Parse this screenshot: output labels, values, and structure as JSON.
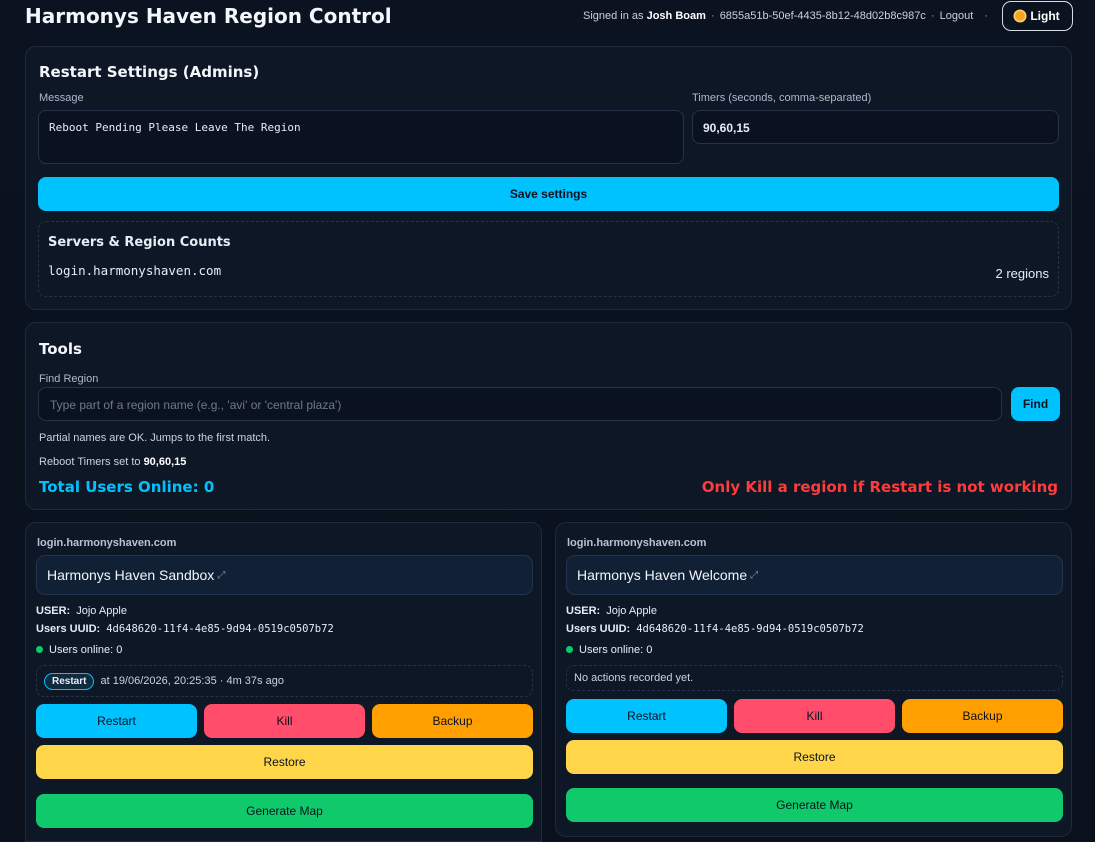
{
  "header": {
    "title": "Harmonys Haven Region Control",
    "signed_in_prefix": "Signed in as",
    "user_name": "Josh Boam",
    "user_uuid": "6855a51b-50ef-4435-8b12-48d02b8c987c",
    "logout_label": "Logout",
    "theme_label": "Light"
  },
  "restart_settings": {
    "title": "Restart Settings (Admins)",
    "message_label": "Message",
    "message_value": "Reboot Pending Please Leave The Region",
    "timers_label": "Timers (seconds, comma-separated)",
    "timers_value": "90,60,15",
    "save_label": "Save settings",
    "servers_title": "Servers & Region Counts",
    "server_host": "login.harmonyshaven.com",
    "server_count": "2 regions"
  },
  "tools": {
    "title": "Tools",
    "find_label": "Find Region",
    "find_placeholder": "Type part of a region name (e.g., 'avi' or 'central plaza')",
    "find_button": "Find",
    "hint": "Partial names are OK. Jumps to the first match.",
    "reboot_prefix": "Reboot Timers set to",
    "reboot_value": "90,60,15",
    "total_users": "Total Users Online: 0",
    "warning": "Only Kill a region if Restart is not working"
  },
  "regions": [
    {
      "host": "login.harmonyshaven.com",
      "name": "Harmonys Haven Sandbox",
      "user_label": "USER:",
      "user_value": "Jojo Apple",
      "uuid_label": "Users UUID:",
      "uuid_value": "4d648620-11f4-4e85-9d94-0519c0507b72",
      "online": "Users online: 0",
      "action_pill": "Restart",
      "action_text": "at 19/06/2026, 20:25:35 · 4m 37s ago",
      "buttons": {
        "restart": "Restart",
        "kill": "Kill",
        "backup": "Backup",
        "restore": "Restore",
        "generate": "Generate Map"
      }
    },
    {
      "host": "login.harmonyshaven.com",
      "name": "Harmonys Haven Welcome",
      "user_label": "USER:",
      "user_value": "Jojo Apple",
      "uuid_label": "Users UUID:",
      "uuid_value": "4d648620-11f4-4e85-9d94-0519c0507b72",
      "online": "Users online: 0",
      "action_text": "No actions recorded yet.",
      "buttons": {
        "restart": "Restart",
        "kill": "Kill",
        "backup": "Backup",
        "restore": "Restore",
        "generate": "Generate Map"
      }
    }
  ],
  "colors": {
    "accent": "#00c2ff",
    "danger": "#ff3b3b",
    "kill": "#ff4d6b",
    "backup": "#ff9f00",
    "restore": "#ffd54a",
    "generate": "#10c96b",
    "online_dot": "#10c96b"
  }
}
